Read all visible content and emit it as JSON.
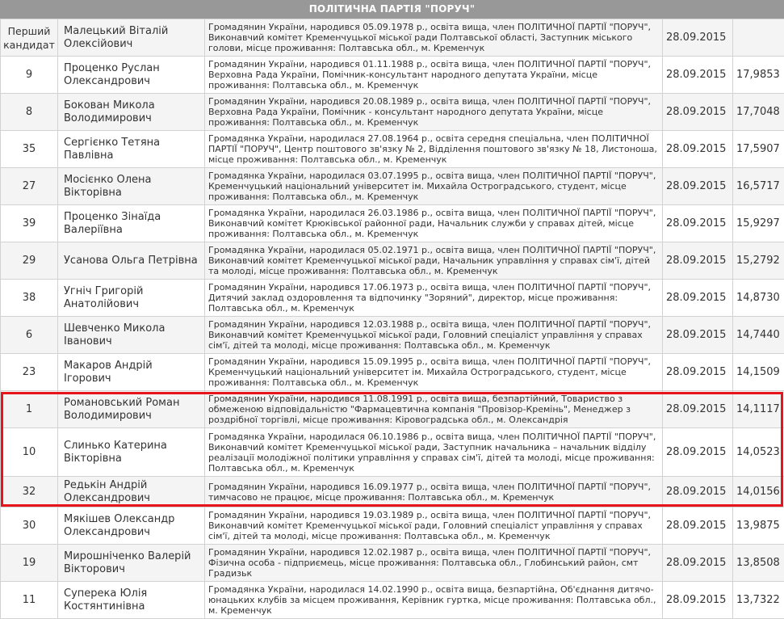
{
  "party_title": "ПОЛІТИЧНА ПАРТІЯ \"ПОРУЧ\"",
  "first_candidate_label": "Перший кандидат",
  "rows": [
    {
      "num": "",
      "name": "Малецький Віталій Олексійович",
      "desc": "Громадянин України, народився 05.09.1978 р., освіта вища, член ПОЛІТИЧНОЇ ПАРТІЇ \"ПОРУЧ\", Виконавчий комітет Кременчуцької міської ради Полтавської області, Заступник міського голови, місце проживання: Полтавська обл., м. Кременчук",
      "date": "28.09.2015",
      "value": ""
    },
    {
      "num": "9",
      "name": "Проценко Руслан Олександрович",
      "desc": "Громадянин України, народився 01.11.1988 р., освіта вища, член ПОЛІТИЧНОЇ ПАРТІЇ \"ПОРУЧ\", Верховна Рада України, Помічник-консультант народного депутата України, місце проживання: Полтавська обл., м. Кременчук",
      "date": "28.09.2015",
      "value": "17,9853"
    },
    {
      "num": "8",
      "name": "Бокован Микола Володимирович",
      "desc": "Громадянин України, народився 20.08.1989 р., освіта вища, член ПОЛІТИЧНОЇ ПАРТІЇ \"ПОРУЧ\", Верховна Рада України, Помічник - консультант народного депутата України, місце проживання: Полтавська обл., м. Кременчук",
      "date": "28.09.2015",
      "value": "17,7048"
    },
    {
      "num": "35",
      "name": "Сергієнко Тетяна Павлівна",
      "desc": "Громадянка України, народилася 27.08.1964 р., освіта середня спеціальна, член ПОЛІТИЧНОЇ ПАРТІЇ \"ПОРУЧ\", Центр поштового зв'язку № 2, Відділення поштового зв'язку № 18, Листоноша, місце проживання: Полтавська обл., м. Кременчук",
      "date": "28.09.2015",
      "value": "17,5907"
    },
    {
      "num": "27",
      "name": "Мосієнко Олена Вікторівна",
      "desc": "Громадянка України, народилася 03.07.1995 р., освіта вища, член ПОЛІТИЧНОЇ ПАРТІЇ \"ПОРУЧ\", Кременчуцький національний університет ім. Михайла Остроградського, студент, місце проживання: Полтавська обл., м. Кременчук",
      "date": "28.09.2015",
      "value": "16,5717"
    },
    {
      "num": "39",
      "name": "Проценко Зінаїда Валеріївна",
      "desc": "Громадянка України, народилася 26.03.1986 р., освіта вища, член ПОЛІТИЧНОЇ ПАРТІЇ \"ПОРУЧ\", Виконавчий комітет Крюківської районної ради, Начальник служби у справах дітей, місце проживання: Полтавська обл., м. Кременчук",
      "date": "28.09.2015",
      "value": "15,9297"
    },
    {
      "num": "29",
      "name": "Усанова Ольга Петрівна",
      "desc": "Громадянка України, народилася 05.02.1971 р., освіта вища, член ПОЛІТИЧНОЇ ПАРТІЇ \"ПОРУЧ\", Виконавчий комітет Кременчуцької міської ради, Начальник управління у справах сім'ї, дітей та молоді, місце проживання: Полтавська обл., м. Кременчук",
      "date": "28.09.2015",
      "value": "15,2792"
    },
    {
      "num": "38",
      "name": "Угніч Григорій Анатолійович",
      "desc": "Громадянин України, народився 17.06.1973 р., освіта вища, член ПОЛІТИЧНОЇ ПАРТІЇ \"ПОРУЧ\", Дитячий заклад оздоровлення та відпочинку \"Зоряний\", директор, місце проживання: Полтавська обл., м. Кременчук",
      "date": "28.09.2015",
      "value": "14,8730"
    },
    {
      "num": "6",
      "name": "Шевченко Микола Іванович",
      "desc": "Громадянин України, народився 12.03.1988 р., освіта вища, член ПОЛІТИЧНОЇ ПАРТІЇ \"ПОРУЧ\", Виконавчий комітет Кременчуцької міської ради, Головний спеціаліст управління у справах сім'ї, дітей та молоді, місце проживання: Полтавська обл., м. Кременчук",
      "date": "28.09.2015",
      "value": "14,7440"
    },
    {
      "num": "23",
      "name": "Макаров Андрій Ігорович",
      "desc": "Громадянин України, народився 15.09.1995 р., освіта вища, член ПОЛІТИЧНОЇ ПАРТІЇ \"ПОРУЧ\", Кременчуцький національний університет ім. Михайла Остроградського, студент, місце проживання: Полтавська обл., м. Кременчук",
      "date": "28.09.2015",
      "value": "14,1509"
    },
    {
      "num": "1",
      "name": "Романовський Роман Володимирович",
      "desc": "Громадянин України, народився 11.08.1991 р., освіта вища, безпартійний, Товариство з обмеженою відповідальністю \"Фармацевтична компанія \"Провізор-Кремінь\", Менеджер з роздрібної торгівлі, місце проживання: Кіровоградська обл., м. Олександрія",
      "date": "28.09.2015",
      "value": "14,1117"
    },
    {
      "num": "10",
      "name": "Слинько Катерина Вікторівна",
      "desc": "Громадянка України, народилася 06.10.1986 р., освіта вища, член ПОЛІТИЧНОЇ ПАРТІЇ \"ПОРУЧ\", Виконавчий комітет Кременчуцької міської ради, Заступник начальника – начальник відділу реалізації молодіжної політики управління у справах сім'ї, дітей та молоді, місце проживання: Полтавська обл., м. Кременчук",
      "date": "28.09.2015",
      "value": "14,0523"
    },
    {
      "num": "32",
      "name": "Редькін Андрій Олександрович",
      "desc": "Громадянин України, народився 16.09.1977 р., освіта вища, член ПОЛІТИЧНОЇ ПАРТІЇ \"ПОРУЧ\", тимчасово не працює, місце проживання: Полтавська обл., м. Кременчук",
      "date": "28.09.2015",
      "value": "14,0156"
    },
    {
      "num": "30",
      "name": "Мякішев Олександр Олександрович",
      "desc": "Громадянин України, народився 19.03.1989 р., освіта вища, член ПОЛІТИЧНОЇ ПАРТІЇ \"ПОРУЧ\", Виконавчий комітет Кременчуцької міської ради, Головний спеціаліст управління у справах сім'ї, дітей та молоді, місце проживання: Полтавська обл., м. Кременчук",
      "date": "28.09.2015",
      "value": "13,9875"
    },
    {
      "num": "19",
      "name": "Мирошніченко Валерій Вікторович",
      "desc": "Громадянин України, народився 12.02.1987 р., освіта вища, член ПОЛІТИЧНОЇ ПАРТІЇ \"ПОРУЧ\", Фізична особа - підприємець, місце проживання: Полтавська обл., Глобинський район, смт Градизьк",
      "date": "28.09.2015",
      "value": "13,8508"
    },
    {
      "num": "11",
      "name": "Суперека Юлія Костянтинівна",
      "desc": "Громадянка України, народилася 14.02.1990 р., освіта вища, безпартійна, Об'єднання дитячо-юнацьких клубів за місцем проживання, Керівник гуртка, місце проживання: Полтавська обл., м. Кременчук",
      "date": "28.09.2015",
      "value": "13,7322"
    }
  ],
  "colors": {
    "header_bg": "#989898",
    "highlight_border": "#e8141b",
    "row_alt_bg": "#f4f4f4"
  }
}
